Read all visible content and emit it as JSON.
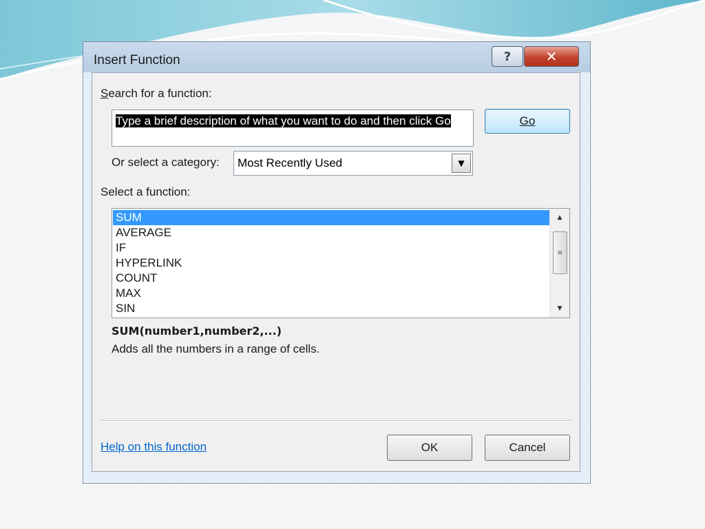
{
  "dialog": {
    "title": "Insert Function",
    "help_button_label": "?",
    "close_button_label": "✕",
    "search": {
      "label_prefix": "",
      "label_accel": "S",
      "label_rest": "earch for a function:",
      "value": "Type a brief description of what you want to do and then click Go",
      "go_label": "Go"
    },
    "category": {
      "label": "Or select a category:",
      "selected": "Most Recently Used"
    },
    "functions": {
      "label": "Select a function:",
      "items": [
        "SUM",
        "AVERAGE",
        "IF",
        "HYPERLINK",
        "COUNT",
        "MAX",
        "SIN"
      ],
      "selected": "SUM"
    },
    "signature": "SUM(number1,number2,...)",
    "description": "Adds all the numbers in a range of cells.",
    "help_link": "Help on this function",
    "ok_label": "OK",
    "cancel_label": "Cancel"
  },
  "colors": {
    "selection": "#3399ff",
    "link": "#0066cc",
    "close_button": "#c2452f"
  }
}
